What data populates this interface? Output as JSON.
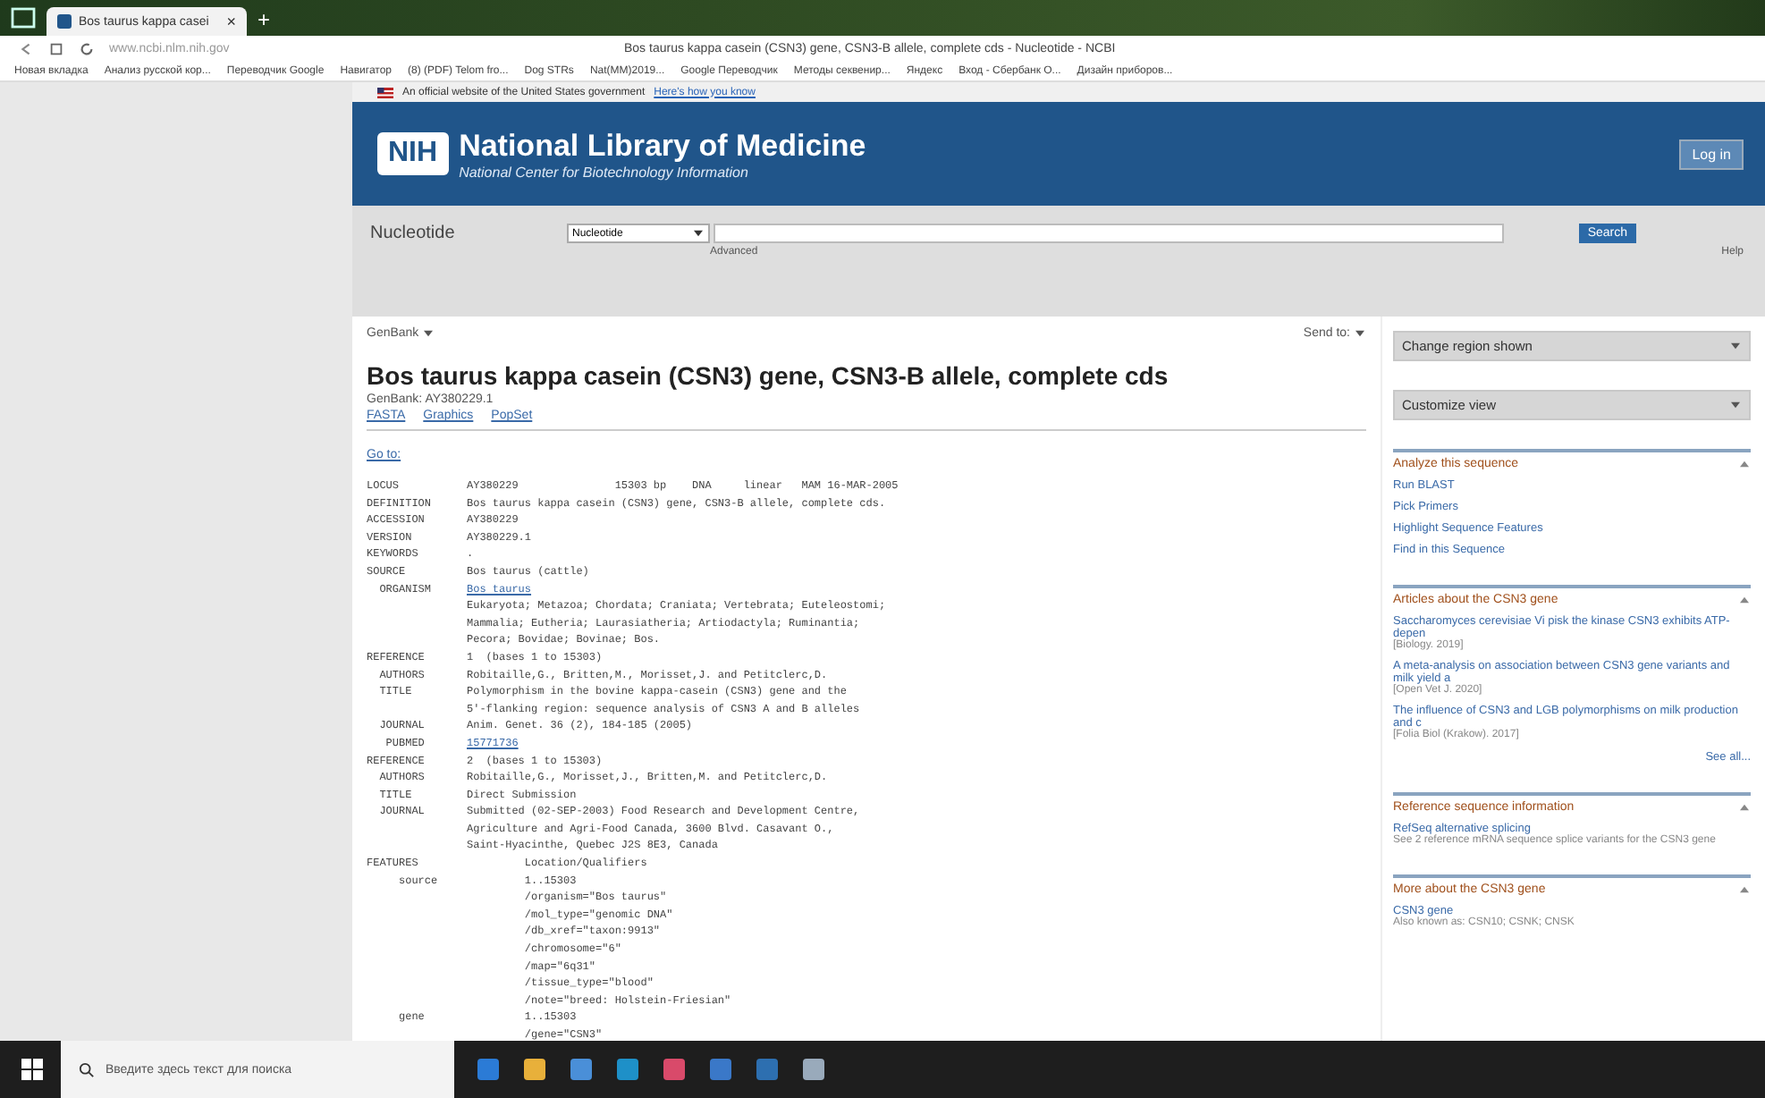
{
  "browser": {
    "tab_title": "Bos taurus kappa casei",
    "tab_close": "×",
    "new_tab": "+",
    "address": "www.ncbi.nlm.nih.gov",
    "page_title": "Bos taurus kappa casein (CSN3) gene, CSN3-B allele, complete cds - Nucleotide - NCBI",
    "bookmarks": [
      "Новая вкладка",
      "Анализ русской кор...",
      "Переводчик Google",
      "Навигатор",
      "(8) (PDF) Telom fro...",
      "Dog STRs",
      "Nat(MM)2019...",
      "Google Переводчик",
      "Методы секвенир...",
      "Яндекс",
      "Вход - Сбербанк О...",
      "Дизайн приборов..."
    ]
  },
  "gov_banner": {
    "text": "An official website of the United States government",
    "link": "Here's how you know"
  },
  "header": {
    "logo": "NIH",
    "title": "National Library of Medicine",
    "subtitle": "National Center for Biotechnology Information",
    "login": "Log in"
  },
  "search": {
    "database_label": "Nucleotide",
    "select": "Nucleotide",
    "button": "Search",
    "advanced": "Advanced",
    "help": "Help"
  },
  "record": {
    "format": "GenBank",
    "send_to": "Send to:",
    "title": "Bos taurus kappa casein (CSN3) gene, CSN3-B allele, complete cds",
    "accession": "GenBank: AY380229.1",
    "links": [
      "FASTA",
      "Graphics",
      "PopSet"
    ],
    "goto": "Go to:",
    "lines": [
      {
        "key": "LOCUS",
        "value": "AY380229               15303 bp    DNA     linear   MAM 16-MAR-2005",
        "kind": "text"
      },
      {
        "key": "DEFINITION",
        "value": "Bos taurus kappa casein (CSN3) gene, CSN3-B allele, complete cds.",
        "kind": "text"
      },
      {
        "key": "ACCESSION",
        "value": "AY380229",
        "kind": "text"
      },
      {
        "key": "VERSION",
        "value": "AY380229.1",
        "kind": "text"
      },
      {
        "key": "KEYWORDS",
        "value": ".",
        "kind": "text"
      },
      {
        "key": "SOURCE",
        "value": "Bos taurus (cattle)",
        "kind": "text"
      },
      {
        "key": "  ORGANISM",
        "value": "Bos taurus",
        "kind": "link"
      },
      {
        "value": "Eukaryota; Metazoa; Chordata; Craniata; Vertebrata; Euteleostomi;",
        "kind": "text"
      },
      {
        "value": "Mammalia; Eutheria; Laurasiatheria; Artiodactyla; Ruminantia;",
        "kind": "text"
      },
      {
        "value": "Pecora; Bovidae; Bovinae; Bos.",
        "kind": "text"
      },
      {
        "key": "REFERENCE",
        "value": "1  (bases 1 to 15303)",
        "kind": "text"
      },
      {
        "key": "  AUTHORS",
        "value": "Robitaille,G., Britten,M., Morisset,J. and Petitclerc,D.",
        "kind": "text"
      },
      {
        "key": "  TITLE",
        "value": "Polymorphism in the bovine kappa-casein (CSN3) gene and the",
        "kind": "text"
      },
      {
        "value": "5'-flanking region: sequence analysis of CSN3 A and B alleles",
        "kind": "text"
      },
      {
        "key": "  JOURNAL",
        "value": "Anim. Genet. 36 (2), 184-185 (2005)",
        "kind": "text"
      },
      {
        "key": "   PUBMED",
        "value": "15771736",
        "kind": "link"
      },
      {
        "key": "REFERENCE",
        "value": "2  (bases 1 to 15303)",
        "kind": "text"
      },
      {
        "key": "  AUTHORS",
        "value": "Robitaille,G., Morisset,J., Britten,M. and Petitclerc,D.",
        "kind": "text"
      },
      {
        "key": "  TITLE",
        "value": "Direct Submission",
        "kind": "text"
      },
      {
        "key": "  JOURNAL",
        "value": "Submitted (02-SEP-2003) Food Research and Development Centre,",
        "kind": "text"
      },
      {
        "value": "Agriculture and Agri-Food Canada, 3600 Blvd. Casavant O.,",
        "kind": "text"
      },
      {
        "value": "Saint-Hyacinthe, Quebec J2S 8E3, Canada",
        "kind": "text"
      },
      {
        "key": "FEATURES",
        "value": "         Location/Qualifiers",
        "kind": "text"
      },
      {
        "key": "     source",
        "value": "         1..15303",
        "kind": "text"
      },
      {
        "value": "         /organism=\"Bos taurus\"",
        "kind": "text"
      },
      {
        "value": "         /mol_type=\"genomic DNA\"",
        "kind": "text"
      },
      {
        "value": "         /db_xref=\"taxon:9913\"",
        "kind": "text"
      },
      {
        "value": "         /chromosome=\"6\"",
        "kind": "text"
      },
      {
        "value": "         /map=\"6q31\"",
        "kind": "text"
      },
      {
        "value": "         /tissue_type=\"blood\"",
        "kind": "text"
      },
      {
        "value": "         /note=\"breed: Holstein-Friesian\"",
        "kind": "text"
      },
      {
        "key": "     gene",
        "value": "         1..15303",
        "kind": "text"
      },
      {
        "value": "         /gene=\"CSN3\"",
        "kind": "text"
      }
    ]
  },
  "sidebar": {
    "dropdowns": [
      {
        "label": "Change region shown"
      },
      {
        "label": "Customize view"
      }
    ],
    "sections": [
      {
        "title": "Analyze this sequence",
        "items": [
          {
            "text": "Run BLAST"
          },
          {
            "text": "Pick Primers"
          },
          {
            "text": "Highlight Sequence Features"
          },
          {
            "text": "Find in this Sequence"
          }
        ]
      },
      {
        "title": "Articles about the CSN3 gene",
        "items": [
          {
            "text": "Saccharomyces cerevisiae Vi pisk the kinase CSN3 exhibits ATP-depen",
            "note": "[Biology. 2019]"
          },
          {
            "text": "A meta-analysis on association between CSN3 gene variants and milk yield a",
            "note": "[Open Vet J. 2020]"
          },
          {
            "text": "The influence of CSN3 and LGB polymorphisms on milk production and c",
            "note": "[Folia Biol (Krakow). 2017]"
          }
        ],
        "more": "See all..."
      },
      {
        "title": "Reference sequence information",
        "items": [
          {
            "text": "RefSeq alternative splicing",
            "note": "See 2 reference mRNA sequence splice variants for the CSN3 gene"
          }
        ]
      },
      {
        "title": "More about the CSN3 gene",
        "items": [
          {
            "text": "CSN3 gene",
            "note": "Also known as: CSN10; CSNK; CNSK"
          }
        ]
      }
    ]
  },
  "taskbar": {
    "search_placeholder": "Введите здесь текст для поиска"
  }
}
